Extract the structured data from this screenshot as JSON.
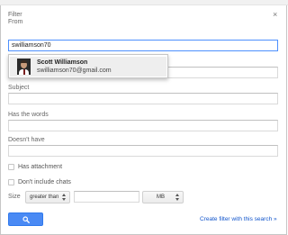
{
  "dialog": {
    "title": "Filter",
    "close_glyph": "×"
  },
  "from": {
    "label": "From",
    "value": "swilliamson70"
  },
  "suggestion": {
    "name": "Scott Williamson",
    "email": "swilliamson70@gmail.com",
    "avatar_icon": "person-photo"
  },
  "to": {
    "value": ""
  },
  "subject": {
    "label": "Subject",
    "value": ""
  },
  "has_words": {
    "label": "Has the words",
    "value": ""
  },
  "doesnt_have": {
    "label": "Doesn't have",
    "value": ""
  },
  "has_attachment": {
    "label": "Has attachment",
    "checked": false
  },
  "dont_include_chats": {
    "label": "Don't include chats",
    "checked": false
  },
  "size": {
    "label": "Size",
    "comparator": "greater than",
    "value": "",
    "unit": "MB"
  },
  "actions": {
    "search_icon": "search-icon",
    "create_filter_label": "Create filter with this search »"
  },
  "colors": {
    "accent": "#4a8af4",
    "link": "#1155cc",
    "focus_border": "#4d90fe"
  }
}
